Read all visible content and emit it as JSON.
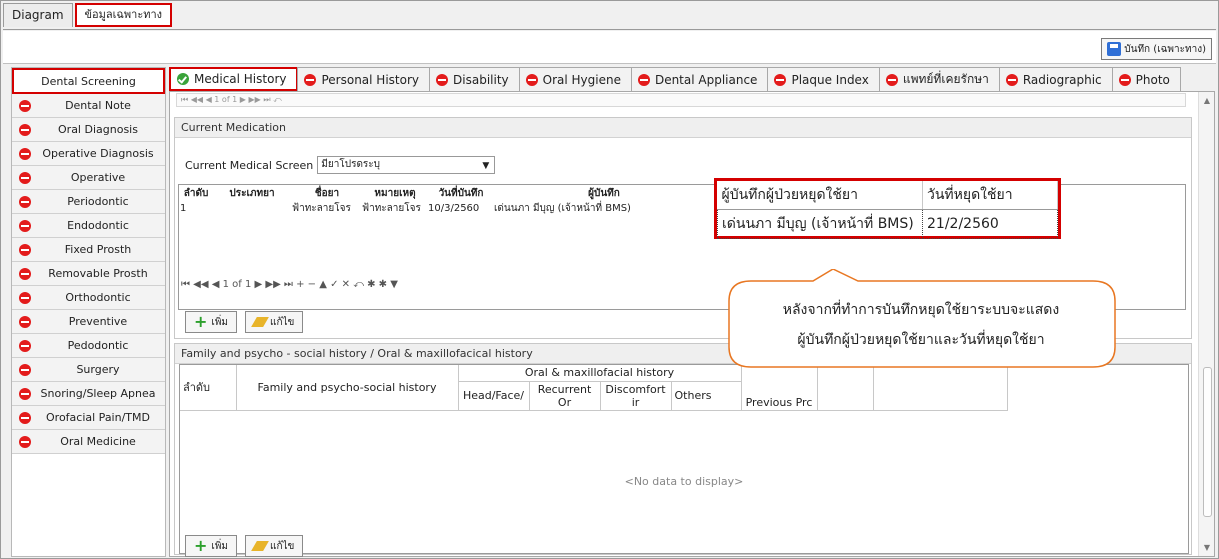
{
  "top_tabs": [
    "Diagram",
    "ข้อมูลเฉพาะทาง"
  ],
  "save_label": "บันทึก (เฉพาะทาง)",
  "sidebar": {
    "items": [
      {
        "label": "Dental Screening",
        "status": "active"
      },
      {
        "label": "Dental Note",
        "status": "stop"
      },
      {
        "label": "Oral Diagnosis",
        "status": "stop"
      },
      {
        "label": "Operative Diagnosis",
        "status": "stop"
      },
      {
        "label": "Operative",
        "status": "stop"
      },
      {
        "label": "Periodontic",
        "status": "stop"
      },
      {
        "label": "Endodontic",
        "status": "stop"
      },
      {
        "label": "Fixed Prosth",
        "status": "stop"
      },
      {
        "label": "Removable Prosth",
        "status": "stop"
      },
      {
        "label": "Orthodontic",
        "status": "stop"
      },
      {
        "label": "Preventive",
        "status": "stop"
      },
      {
        "label": "Pedodontic",
        "status": "stop"
      },
      {
        "label": "Surgery",
        "status": "stop"
      },
      {
        "label": "Snoring/Sleep Apnea",
        "status": "stop"
      },
      {
        "label": "Orofacial Pain/TMD",
        "status": "stop"
      },
      {
        "label": "Oral Medicine",
        "status": "stop"
      }
    ]
  },
  "main_tabs": [
    {
      "label": "Medical History",
      "status": "check"
    },
    {
      "label": "Personal History",
      "status": "stop"
    },
    {
      "label": "Disability",
      "status": "stop"
    },
    {
      "label": "Oral Hygiene",
      "status": "stop"
    },
    {
      "label": "Dental Appliance",
      "status": "stop"
    },
    {
      "label": "Plaque Index",
      "status": "stop"
    },
    {
      "label": "แพทย์ที่เคยรักษา",
      "status": "stop"
    },
    {
      "label": "Radiographic",
      "status": "stop"
    },
    {
      "label": "Photo",
      "status": "stop"
    }
  ],
  "top_nav": "⏮ ◀◀ ◀ 1 of 1 ▶ ▶▶ ⏭ ⤺",
  "current_medication": {
    "heading": "Current Medication",
    "screen_label": "Current Medical Screen",
    "screen_value": "มียาโปรดระบุ",
    "columns": [
      "ลำดับ",
      "ประเภทยา",
      "ชื่อยา",
      "หมายเหตุ",
      "วันที่บันทึก",
      "ผู้บันทึก"
    ],
    "rows": [
      [
        "1",
        "",
        "ฟ้าทะลายโจร",
        "ฟ้าทะลายโจร",
        "10/3/2560",
        "เด่นนภา มีบุญ (เจ้าหน้าที่ BMS)"
      ]
    ],
    "stop_columns": [
      "ผู้บันทึกผู้ป่วยหยุดใช้ยา",
      "วันที่หยุดใช้ยา"
    ],
    "stop_row": [
      "เด่นนภา มีบุญ (เจ้าหน้าที่ BMS)",
      "21/2/2560"
    ],
    "nav": "⏮ ◀◀ ◀ 1 of 1 ▶ ▶▶ ⏭ + − ▲ ✓ ✕ ⤺ ✱ ✱ ▼",
    "add_label": "เพิ่ม",
    "edit_label": "แก้ไข"
  },
  "family_history": {
    "heading": "Family and psycho - social history / Oral & maxillofacical history",
    "col_index": "ลำดับ",
    "col_family": "Family and psycho-social history",
    "col_oral_group": "Oral & maxillofacial history",
    "sub_cols": [
      "Head/Face/",
      "Recurrent Or",
      "Discomfort ir",
      "Others"
    ],
    "col_previous": "Previous Prc",
    "no_data": "<No data to display>",
    "add_label": "เพิ่ม",
    "edit_label": "แก้ไข"
  },
  "callout": {
    "line1": "หลังจากที่ทำการบันทึกหยุดใช้ยาระบบจะแสดง",
    "line2": "ผู้บันทึกผู้ป่วยหยุดใช้ยาและวันที่หยุดใช้ยา"
  },
  "colors": {
    "highlight": "#d40000",
    "stop": "#e31b1b",
    "check": "#3aa33a",
    "callout_border": "#e87722"
  }
}
